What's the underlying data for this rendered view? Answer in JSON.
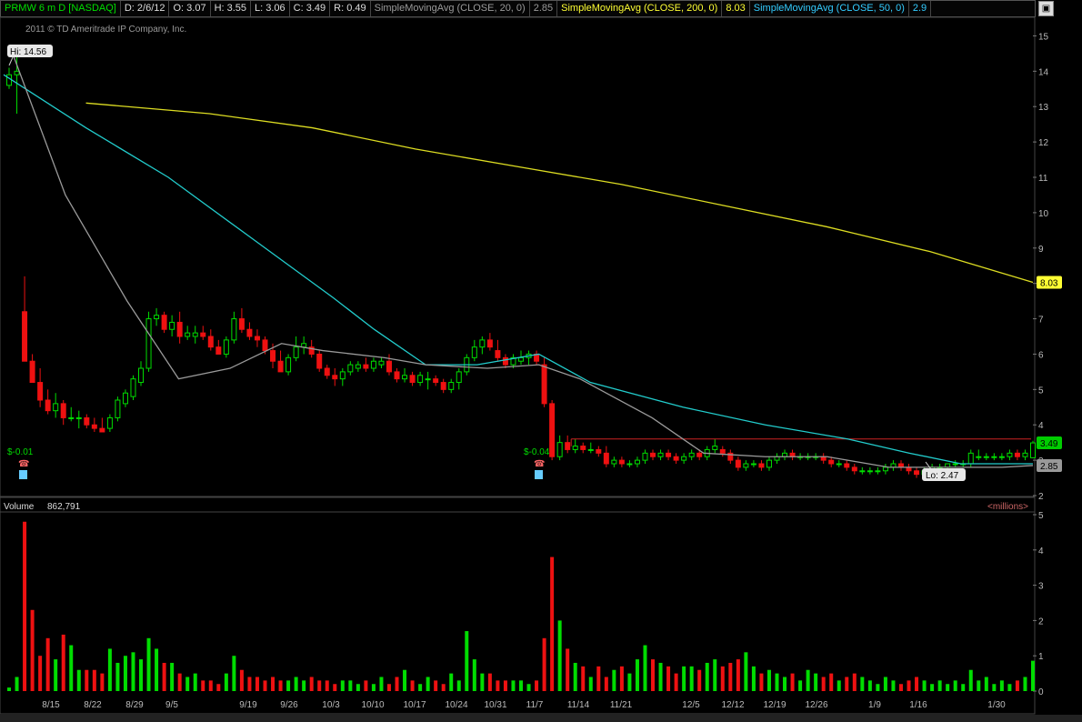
{
  "header": {
    "symbol": "PRMW 6 m D [NASDAQ]",
    "date": "D: 2/6/12",
    "open": "O: 3.07",
    "high": "H: 3.55",
    "low": "L: 3.06",
    "close": "C: 3.49",
    "range": "R: 0.49",
    "sma20_label": "SimpleMovingAvg (CLOSE, 20, 0)",
    "sma20_value": "2.85",
    "sma200_label": "SimpleMovingAvg (CLOSE, 200, 0)",
    "sma200_value": "8.03",
    "sma50_label": "SimpleMovingAvg (CLOSE, 50, 0)",
    "sma50_value": "2.9"
  },
  "copyright": "2011 © TD Ameritrade IP Company, Inc.",
  "hi_label": "Hi: 14.56",
  "lo_label": "Lo: 2.47",
  "earnings": [
    "$-0.01",
    "$-0.04"
  ],
  "volume_panel": {
    "label": "Volume",
    "value": "862,791",
    "units": "<millions>"
  },
  "colors": {
    "up": "#00dd00",
    "down": "#ee1111",
    "sma20": "#9a9a9a",
    "sma50": "#22cccc",
    "sma200": "#dddd22",
    "resistance": "#cc2222"
  },
  "chart_data": {
    "type": "candlestick",
    "price_axis": {
      "min": 2,
      "max": 15.5,
      "ticks": [
        2,
        3,
        4,
        5,
        6,
        7,
        8,
        9,
        10,
        11,
        12,
        13,
        14,
        15
      ]
    },
    "volume_axis": {
      "min": 0,
      "max": 5,
      "ticks": [
        0,
        1,
        2,
        3,
        4,
        5
      ],
      "unit": "millions"
    },
    "x_tick_labels": [
      "8/15",
      "8/22",
      "8/29",
      "9/5",
      "9/19",
      "9/26",
      "10/3",
      "10/10",
      "10/17",
      "10/24",
      "10/31",
      "11/7",
      "11/14",
      "11/21",
      "12/5",
      "12/12",
      "12/19",
      "12/26",
      "1/9",
      "1/16",
      "1/30"
    ],
    "last_price_tags": {
      "sma200": "8.03",
      "close": "3.49",
      "sma20": "2.85"
    },
    "resistance_level": 3.6,
    "candles": [
      [
        13.6,
        14.1,
        13.5,
        13.9,
        0.1
      ],
      [
        13.9,
        14.5,
        12.8,
        14.0,
        0.4
      ],
      [
        7.2,
        8.2,
        5.8,
        5.8,
        4.8
      ],
      [
        5.8,
        6.0,
        5.2,
        5.2,
        2.3
      ],
      [
        5.2,
        5.6,
        4.5,
        4.7,
        1.0
      ],
      [
        4.7,
        5.0,
        4.3,
        4.4,
        1.5
      ],
      [
        4.4,
        4.9,
        4.2,
        4.6,
        0.9
      ],
      [
        4.6,
        4.7,
        4.0,
        4.2,
        1.6
      ],
      [
        4.2,
        4.5,
        4.1,
        4.2,
        1.3
      ],
      [
        4.2,
        4.4,
        3.9,
        4.2,
        0.6
      ],
      [
        4.2,
        4.3,
        3.9,
        4.0,
        0.6
      ],
      [
        4.0,
        4.2,
        3.8,
        3.9,
        0.6
      ],
      [
        3.9,
        4.2,
        3.8,
        3.8,
        0.5
      ],
      [
        3.9,
        4.3,
        3.8,
        4.2,
        1.2
      ],
      [
        4.2,
        4.8,
        4.1,
        4.7,
        0.8
      ],
      [
        4.6,
        5.0,
        4.5,
        4.9,
        1.0
      ],
      [
        4.8,
        5.4,
        4.7,
        5.3,
        1.1
      ],
      [
        5.2,
        5.8,
        5.1,
        5.6,
        0.9
      ],
      [
        5.6,
        7.2,
        5.5,
        7.0,
        1.5
      ],
      [
        7.0,
        7.3,
        6.8,
        7.1,
        1.2
      ],
      [
        7.1,
        7.2,
        6.6,
        6.7,
        0.8
      ],
      [
        6.7,
        7.1,
        6.5,
        6.9,
        0.8
      ],
      [
        6.9,
        7.2,
        6.3,
        6.5,
        0.5
      ],
      [
        6.5,
        6.8,
        6.4,
        6.6,
        0.4
      ],
      [
        6.5,
        6.8,
        6.3,
        6.6,
        0.5
      ],
      [
        6.6,
        6.8,
        6.4,
        6.5,
        0.3
      ],
      [
        6.5,
        6.7,
        6.1,
        6.2,
        0.3
      ],
      [
        6.2,
        6.4,
        6.0,
        6.0,
        0.2
      ],
      [
        6.0,
        6.5,
        5.9,
        6.4,
        0.5
      ],
      [
        6.4,
        7.2,
        6.3,
        7.0,
        1.0
      ],
      [
        7.0,
        7.3,
        6.6,
        6.7,
        0.6
      ],
      [
        6.7,
        6.9,
        6.4,
        6.5,
        0.4
      ],
      [
        6.5,
        6.7,
        6.2,
        6.4,
        0.4
      ],
      [
        6.4,
        6.5,
        6.0,
        6.1,
        0.3
      ],
      [
        6.1,
        6.3,
        5.6,
        5.8,
        0.4
      ],
      [
        5.8,
        6.1,
        5.5,
        5.5,
        0.3
      ],
      [
        5.5,
        6.0,
        5.4,
        5.9,
        0.3
      ],
      [
        5.9,
        6.5,
        5.8,
        6.2,
        0.4
      ],
      [
        6.2,
        6.5,
        6.0,
        6.3,
        0.3
      ],
      [
        6.2,
        6.4,
        5.9,
        6.0,
        0.4
      ],
      [
        6.0,
        6.1,
        5.5,
        5.6,
        0.3
      ],
      [
        5.6,
        5.7,
        5.3,
        5.4,
        0.3
      ],
      [
        5.4,
        5.6,
        5.1,
        5.3,
        0.2
      ],
      [
        5.3,
        5.6,
        5.1,
        5.5,
        0.3
      ],
      [
        5.5,
        5.8,
        5.4,
        5.7,
        0.3
      ],
      [
        5.6,
        5.8,
        5.5,
        5.7,
        0.2
      ],
      [
        5.7,
        5.9,
        5.5,
        5.6,
        0.3
      ],
      [
        5.6,
        5.9,
        5.5,
        5.8,
        0.2
      ],
      [
        5.7,
        5.9,
        5.6,
        5.8,
        0.4
      ],
      [
        5.8,
        6.0,
        5.4,
        5.5,
        0.2
      ],
      [
        5.5,
        5.6,
        5.2,
        5.3,
        0.4
      ],
      [
        5.3,
        5.6,
        5.2,
        5.4,
        0.6
      ],
      [
        5.4,
        5.5,
        5.1,
        5.2,
        0.3
      ],
      [
        5.2,
        5.5,
        5.1,
        5.4,
        0.2
      ],
      [
        5.3,
        5.5,
        5.0,
        5.3,
        0.4
      ],
      [
        5.3,
        5.4,
        5.1,
        5.2,
        0.3
      ],
      [
        5.2,
        5.3,
        4.9,
        5.0,
        0.2
      ],
      [
        5.0,
        5.3,
        4.9,
        5.2,
        0.5
      ],
      [
        5.2,
        5.6,
        5.0,
        5.5,
        0.3
      ],
      [
        5.5,
        6.0,
        5.4,
        5.9,
        1.7
      ],
      [
        5.9,
        6.4,
        5.8,
        6.2,
        0.9
      ],
      [
        6.2,
        6.5,
        6.0,
        6.4,
        0.5
      ],
      [
        6.4,
        6.6,
        6.1,
        6.2,
        0.5
      ],
      [
        6.1,
        6.4,
        5.8,
        5.9,
        0.3
      ],
      [
        5.9,
        6.0,
        5.6,
        5.7,
        0.3
      ],
      [
        5.7,
        6.0,
        5.6,
        5.9,
        0.3
      ],
      [
        5.8,
        6.1,
        5.7,
        5.9,
        0.3
      ],
      [
        5.9,
        6.1,
        5.7,
        6.0,
        0.2
      ],
      [
        6.0,
        6.1,
        5.7,
        5.8,
        0.3
      ],
      [
        5.7,
        5.9,
        4.5,
        4.6,
        1.5
      ],
      [
        4.6,
        4.7,
        3.0,
        3.1,
        3.8
      ],
      [
        3.1,
        3.7,
        3.0,
        3.5,
        2.0
      ],
      [
        3.5,
        3.7,
        3.2,
        3.3,
        1.2
      ],
      [
        3.3,
        3.6,
        3.2,
        3.4,
        0.8
      ],
      [
        3.4,
        3.5,
        3.2,
        3.3,
        0.7
      ],
      [
        3.3,
        3.5,
        3.2,
        3.3,
        0.4
      ],
      [
        3.3,
        3.4,
        3.1,
        3.2,
        0.7
      ],
      [
        3.2,
        3.4,
        2.8,
        2.9,
        0.4
      ],
      [
        2.9,
        3.1,
        2.8,
        3.0,
        0.6
      ],
      [
        3.0,
        3.1,
        2.8,
        2.9,
        0.7
      ],
      [
        2.9,
        3.0,
        2.8,
        2.9,
        0.5
      ],
      [
        2.9,
        3.1,
        2.8,
        3.0,
        0.9
      ],
      [
        3.0,
        3.3,
        2.9,
        3.2,
        1.3
      ],
      [
        3.2,
        3.3,
        3.0,
        3.1,
        0.9
      ],
      [
        3.1,
        3.3,
        3.0,
        3.2,
        0.8
      ],
      [
        3.2,
        3.3,
        3.0,
        3.1,
        0.7
      ],
      [
        3.1,
        3.2,
        2.9,
        3.0,
        0.5
      ],
      [
        3.0,
        3.2,
        2.9,
        3.1,
        0.7
      ],
      [
        3.1,
        3.3,
        3.0,
        3.2,
        0.7
      ],
      [
        3.2,
        3.3,
        3.0,
        3.1,
        0.6
      ],
      [
        3.1,
        3.4,
        3.0,
        3.3,
        0.8
      ],
      [
        3.3,
        3.6,
        3.2,
        3.4,
        0.9
      ],
      [
        3.3,
        3.4,
        3.1,
        3.2,
        0.7
      ],
      [
        3.2,
        3.3,
        2.9,
        3.0,
        0.8
      ],
      [
        3.0,
        3.1,
        2.7,
        2.8,
        0.9
      ],
      [
        2.8,
        3.0,
        2.7,
        2.9,
        1.1
      ],
      [
        2.9,
        3.0,
        2.8,
        2.9,
        0.7
      ],
      [
        2.9,
        3.0,
        2.7,
        2.8,
        0.5
      ],
      [
        2.8,
        3.1,
        2.7,
        3.0,
        0.6
      ],
      [
        3.0,
        3.2,
        2.9,
        3.1,
        0.5
      ],
      [
        3.1,
        3.3,
        3.0,
        3.2,
        0.4
      ],
      [
        3.2,
        3.3,
        3.0,
        3.1,
        0.5
      ],
      [
        3.1,
        3.2,
        3.0,
        3.1,
        0.3
      ],
      [
        3.1,
        3.2,
        3.0,
        3.1,
        0.6
      ],
      [
        3.1,
        3.2,
        3.0,
        3.1,
        0.5
      ],
      [
        3.1,
        3.2,
        2.9,
        3.0,
        0.4
      ],
      [
        3.0,
        3.1,
        2.8,
        2.9,
        0.5
      ],
      [
        2.9,
        3.0,
        2.8,
        2.9,
        0.3
      ],
      [
        2.9,
        3.0,
        2.7,
        2.8,
        0.4
      ],
      [
        2.8,
        2.9,
        2.6,
        2.7,
        0.5
      ],
      [
        2.7,
        2.8,
        2.6,
        2.7,
        0.4
      ],
      [
        2.7,
        2.8,
        2.6,
        2.7,
        0.3
      ],
      [
        2.7,
        2.8,
        2.6,
        2.7,
        0.2
      ],
      [
        2.7,
        2.9,
        2.6,
        2.8,
        0.4
      ],
      [
        2.8,
        3.0,
        2.7,
        2.9,
        0.3
      ],
      [
        2.9,
        3.0,
        2.7,
        2.8,
        0.2
      ],
      [
        2.8,
        2.9,
        2.6,
        2.7,
        0.3
      ],
      [
        2.7,
        2.8,
        2.5,
        2.6,
        0.4
      ],
      [
        2.6,
        2.8,
        2.5,
        2.7,
        0.3
      ],
      [
        2.7,
        2.9,
        2.6,
        2.8,
        0.2
      ],
      [
        2.8,
        2.9,
        2.7,
        2.8,
        0.3
      ],
      [
        2.8,
        2.9,
        2.7,
        2.9,
        0.2
      ],
      [
        2.9,
        3.0,
        2.8,
        2.9,
        0.3
      ],
      [
        2.9,
        3.0,
        2.8,
        2.9,
        0.2
      ],
      [
        2.9,
        3.3,
        2.8,
        3.2,
        0.6
      ],
      [
        3.1,
        3.3,
        3.0,
        3.1,
        0.3
      ],
      [
        3.1,
        3.2,
        3.0,
        3.1,
        0.4
      ],
      [
        3.1,
        3.2,
        3.0,
        3.1,
        0.2
      ],
      [
        3.1,
        3.2,
        3.0,
        3.1,
        0.3
      ],
      [
        3.1,
        3.3,
        3.0,
        3.2,
        0.2
      ],
      [
        3.2,
        3.3,
        3.0,
        3.1,
        0.3
      ],
      [
        3.1,
        3.3,
        3.0,
        3.2,
        0.4
      ],
      [
        3.07,
        3.55,
        3.06,
        3.49,
        0.86
      ]
    ],
    "series": [
      {
        "name": "SimpleMovingAvg (CLOSE, 200, 0)",
        "color": "#dddd22",
        "points": [
          [
            0.08,
            13.1
          ],
          [
            0.2,
            12.8
          ],
          [
            0.3,
            12.4
          ],
          [
            0.4,
            11.8
          ],
          [
            0.5,
            11.3
          ],
          [
            0.6,
            10.8
          ],
          [
            0.7,
            10.2
          ],
          [
            0.8,
            9.6
          ],
          [
            0.9,
            8.9
          ],
          [
            1.0,
            8.03
          ]
        ]
      },
      {
        "name": "SimpleMovingAvg (CLOSE, 50, 0)",
        "color": "#22cccc",
        "points": [
          [
            0.0,
            13.9
          ],
          [
            0.08,
            12.4
          ],
          [
            0.16,
            11.0
          ],
          [
            0.24,
            9.3
          ],
          [
            0.32,
            7.6
          ],
          [
            0.36,
            6.7
          ],
          [
            0.41,
            5.7
          ],
          [
            0.46,
            5.7
          ],
          [
            0.52,
            6.0
          ],
          [
            0.57,
            5.2
          ],
          [
            0.66,
            4.5
          ],
          [
            0.74,
            4.0
          ],
          [
            0.82,
            3.6
          ],
          [
            0.88,
            3.2
          ],
          [
            0.93,
            2.9
          ],
          [
            1.0,
            2.9
          ]
        ]
      },
      {
        "name": "SimpleMovingAvg (CLOSE, 20, 0)",
        "color": "#9a9a9a",
        "points": [
          [
            0.01,
            14.4
          ],
          [
            0.06,
            10.5
          ],
          [
            0.12,
            7.5
          ],
          [
            0.17,
            5.3
          ],
          [
            0.22,
            5.6
          ],
          [
            0.27,
            6.3
          ],
          [
            0.31,
            6.1
          ],
          [
            0.37,
            5.9
          ],
          [
            0.41,
            5.7
          ],
          [
            0.47,
            5.6
          ],
          [
            0.52,
            5.7
          ],
          [
            0.56,
            5.3
          ],
          [
            0.63,
            4.2
          ],
          [
            0.68,
            3.2
          ],
          [
            0.74,
            3.1
          ],
          [
            0.8,
            3.1
          ],
          [
            0.86,
            2.8
          ],
          [
            0.92,
            2.8
          ],
          [
            0.97,
            2.8
          ],
          [
            1.0,
            2.85
          ]
        ]
      }
    ]
  }
}
